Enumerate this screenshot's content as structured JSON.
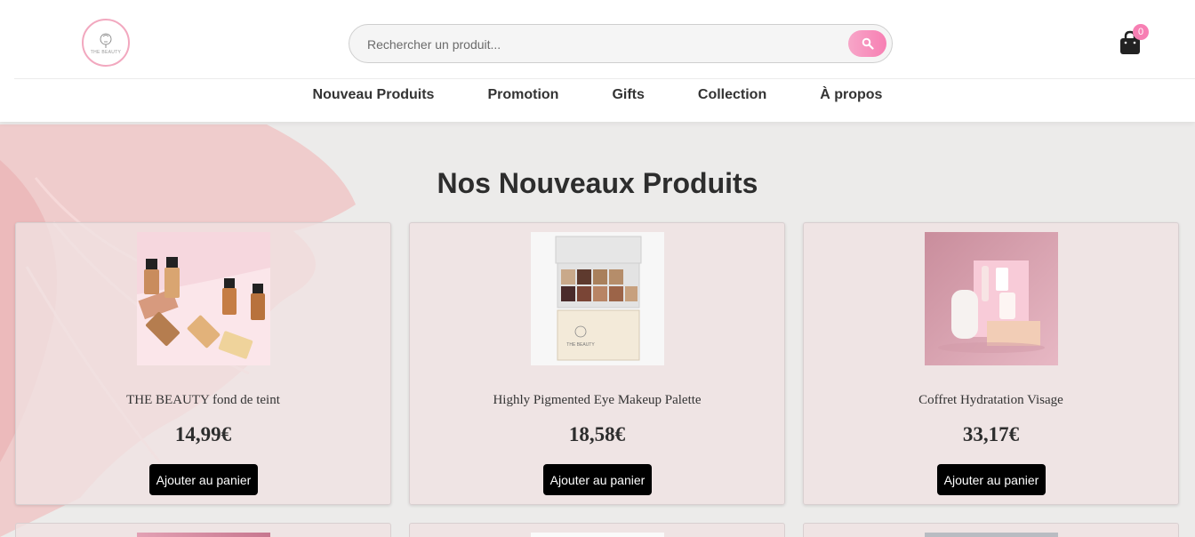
{
  "brand": {
    "logo_text": "THE BEAUTY",
    "accent": "#f77fb3"
  },
  "search": {
    "placeholder": "Rechercher un produit...",
    "value": "",
    "icon": "search-icon"
  },
  "cart": {
    "icon": "shopping-bag-icon",
    "count": "0"
  },
  "nav": {
    "items": [
      {
        "label": "Nouveau Produits"
      },
      {
        "label": "Promotion"
      },
      {
        "label": "Gifts"
      },
      {
        "label": "Collection"
      },
      {
        "label": "À propos"
      }
    ]
  },
  "main": {
    "title": "Nos Nouveaux Produits",
    "products": [
      {
        "name": "THE BEAUTY fond de teint",
        "price": "14,99€",
        "button": "Ajouter au panier"
      },
      {
        "name": "Highly Pigmented Eye Makeup Palette",
        "price": "18,58€",
        "button": "Ajouter au panier"
      },
      {
        "name": "Coffret Hydratation Visage",
        "price": "33,17€",
        "button": "Ajouter au panier"
      }
    ]
  }
}
